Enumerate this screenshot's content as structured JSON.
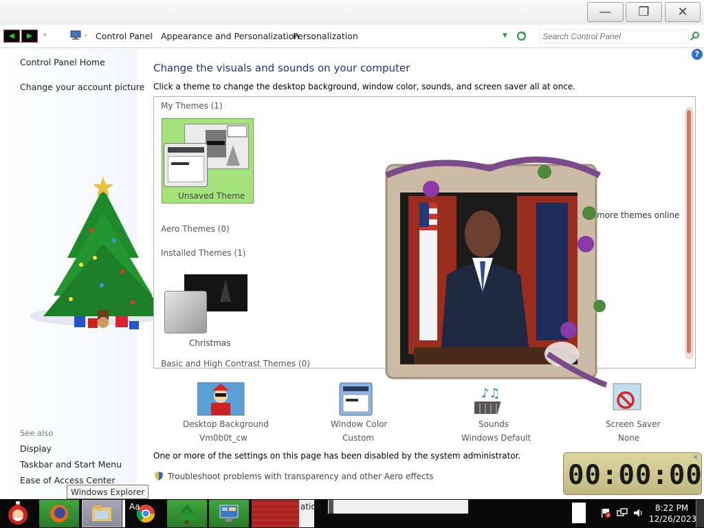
{
  "window": {
    "minimize_glyph": "—",
    "restore_glyph": "❐",
    "close_glyph": "✕"
  },
  "address": {
    "crumbs": [
      "Control Panel",
      "Appearance and Personalization",
      "Personalization"
    ],
    "search_placeholder": "Search Control Panel"
  },
  "sidebar": {
    "links": [
      "Control Panel Home",
      "Change your account picture"
    ],
    "see_also_title": "See also",
    "see_also": [
      "Display",
      "Taskbar and Start Menu",
      "Ease of Access Center"
    ]
  },
  "main": {
    "heading": "Change the visuals and sounds on your computer",
    "subtext": "Click a theme to change the desktop background, window color, sounds, and screen saver all at once.",
    "groups": {
      "my_themes": "My Themes (1)",
      "aero_themes": "Aero Themes (0)",
      "installed_themes": "Installed Themes (1)",
      "basic_themes": "Basic and High Contrast Themes (0)"
    },
    "themes": {
      "unsaved": "Unsaved Theme",
      "christmas": "Christmas"
    },
    "online_link": "more themes online",
    "settings": [
      {
        "label": "Desktop Background",
        "value": "Vm0b0t_cw"
      },
      {
        "label": "Window Color",
        "value": "Custom"
      },
      {
        "label": "Sounds",
        "value": "Windows Default"
      },
      {
        "label": "Screen Saver",
        "value": "None"
      }
    ],
    "disabled_notice": "One or more of the settings on this page has been disabled by the system administrator.",
    "troubleshoot_link": "Troubleshoot problems with transparency and other Aero effects"
  },
  "timer": {
    "display": "00:00:00"
  },
  "tooltip": "Windows Explorer",
  "taskbar": {
    "partial_text_1": "Aa",
    "partial_text_2": "ation",
    "clock_time": "8:22 PM",
    "clock_date": "12/26/2023"
  },
  "colors": {
    "heading": "#1e3287",
    "selected_theme_bg": "#a4e27a",
    "scroll_thumb": "#d9795e",
    "taskbar": "#0a0a0a"
  },
  "icons": [
    "minimize-icon",
    "restore-icon",
    "close-icon",
    "back-icon",
    "forward-icon",
    "computer-icon",
    "refresh-icon",
    "search-icon",
    "help-icon",
    "shield-icon",
    "santa-icon",
    "firefox-icon",
    "explorer-icon",
    "chrome-icon",
    "tree-icon",
    "control-panel-icon",
    "flag-icon",
    "network-icon",
    "volume-icon"
  ]
}
